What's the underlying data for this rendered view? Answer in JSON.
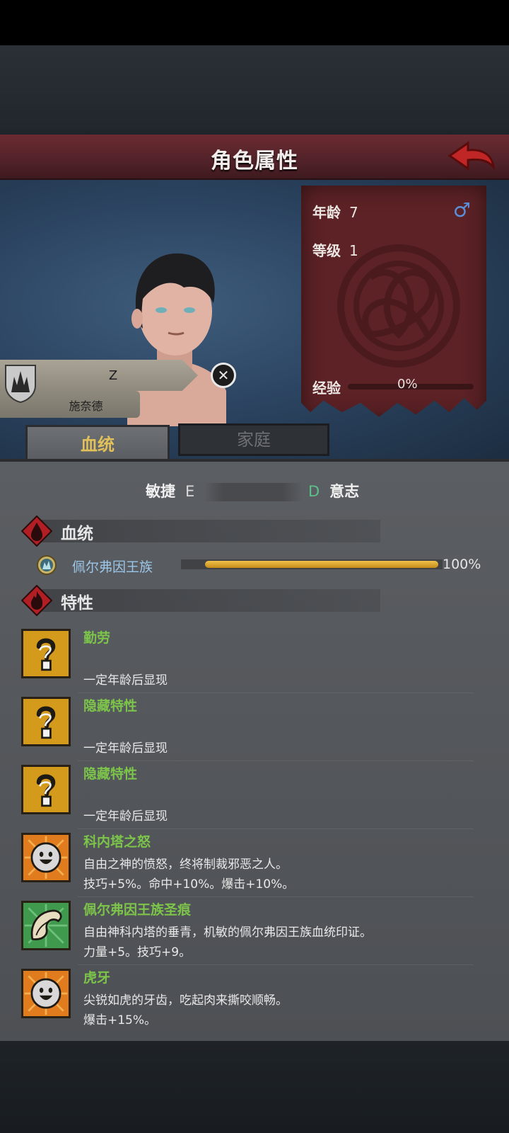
{
  "header": {
    "title": "角色属性"
  },
  "character": {
    "name": "Z",
    "clan": "施奈德",
    "age_label": "年龄",
    "age_value": "7",
    "gender_icon": "male-symbol",
    "level_label": "等级",
    "level_value": "1",
    "exp_label": "经验",
    "exp_value": "0%",
    "exp_progress": 0
  },
  "tabs": [
    {
      "label": "血统",
      "active": true
    },
    {
      "label": "家庭",
      "active": false
    }
  ],
  "stats": {
    "left_name": "敏捷",
    "left_grade": "E",
    "right_grade": "D",
    "right_name": "意志"
  },
  "lineage": {
    "section_title": "血统",
    "name": "佩尔弗因王族",
    "percent_text": "100%",
    "progress": 1.0
  },
  "traits": {
    "section_title": "特性",
    "items": [
      {
        "name": "勤劳",
        "line1": "",
        "line2": "一定年龄后显现",
        "icon": "question-mark"
      },
      {
        "name": "隐藏特性",
        "line1": "",
        "line2": "一定年龄后显现",
        "icon": "question-mark"
      },
      {
        "name": "隐藏特性",
        "line1": "",
        "line2": "一定年龄后显现",
        "icon": "question-mark"
      },
      {
        "name": "科内塔之怒",
        "line1": "自由之神的愤怒，终将制裁邪恶之人。",
        "line2": "技巧+5%。命中+10%。爆击+10%。",
        "icon": "smiley-face"
      },
      {
        "name": "佩尔弗因王族圣痕",
        "line1": "自由神科内塔的垂青，机敏的佩尔弗因王族血统印证。",
        "line2": "力量+5。技巧+9。",
        "icon": "feather-swirl"
      },
      {
        "name": "虎牙",
        "line1": "尖锐如虎的牙齿，吃起肉来撕咬顺畅。",
        "line2": "爆击+15%。",
        "icon": "smiley-face"
      }
    ]
  },
  "colors": {
    "header_red": "#6b2b30",
    "trait_name_green": "#7cc44a",
    "tab_active_gold": "#e2c15a",
    "lineage_bar": "#e0a830"
  }
}
